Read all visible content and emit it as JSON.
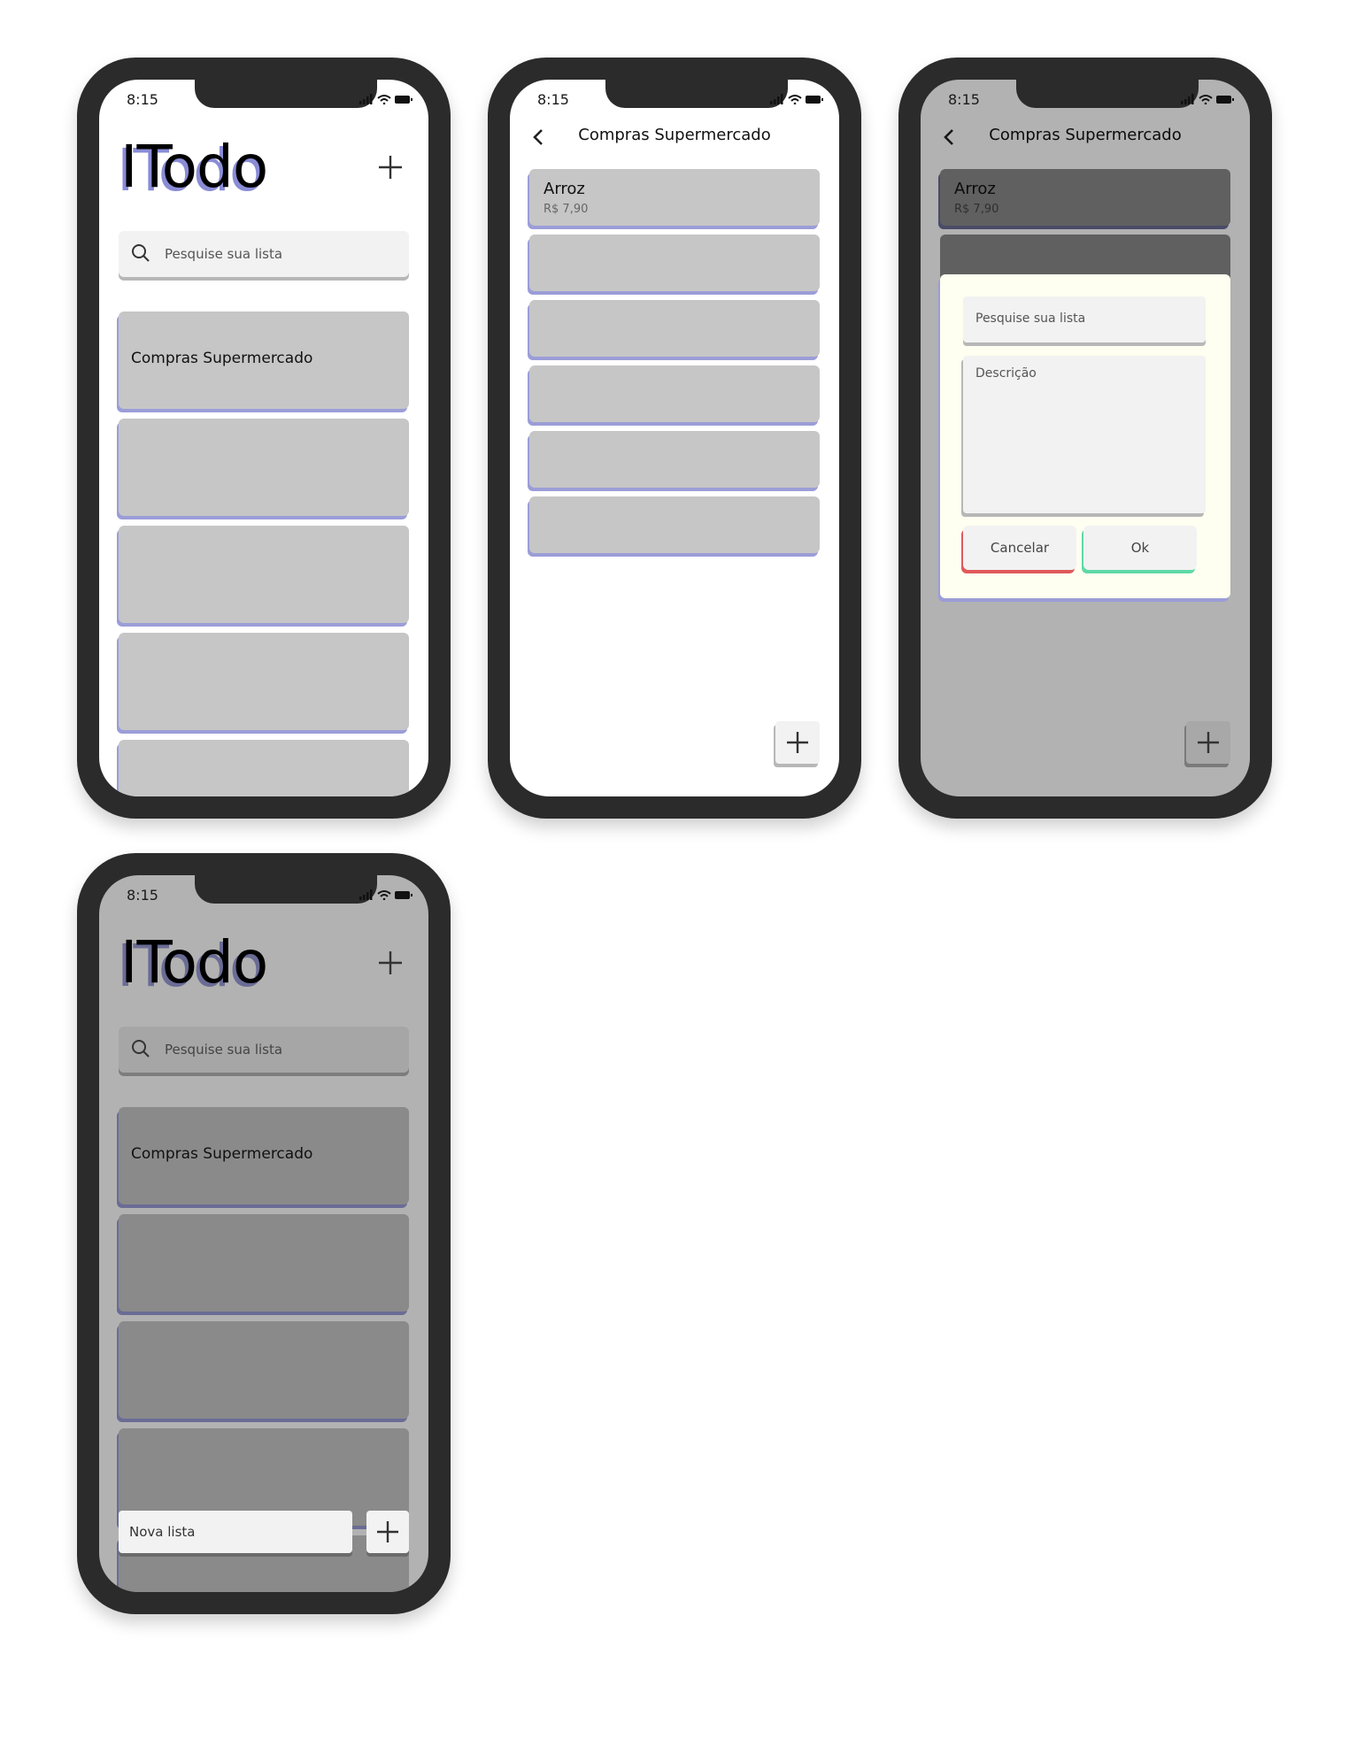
{
  "status_bar": {
    "time": "8:15"
  },
  "home": {
    "title": "ITodo",
    "search_placeholder": "Pesquise sua lista",
    "lists": [
      "Compras Supermercado",
      "",
      "",
      "",
      ""
    ]
  },
  "detail": {
    "title": "Compras Supermercado",
    "items": [
      {
        "name": "Arroz",
        "price": "R$ 7,90"
      }
    ]
  },
  "modal": {
    "name_placeholder": "Pesquise sua lista",
    "description_placeholder": "Descrição",
    "cancel_label": "Cancelar",
    "ok_label": "Ok"
  },
  "new_list": {
    "placeholder": "Nova lista"
  },
  "colors": {
    "frame": "#2b2b2b",
    "card": "#c6c6c6",
    "card_shadow": "#9b9dd8",
    "modal_bg": "#fefff0",
    "cancel_accent": "#e05a5a",
    "ok_accent": "#5ed9a6"
  }
}
